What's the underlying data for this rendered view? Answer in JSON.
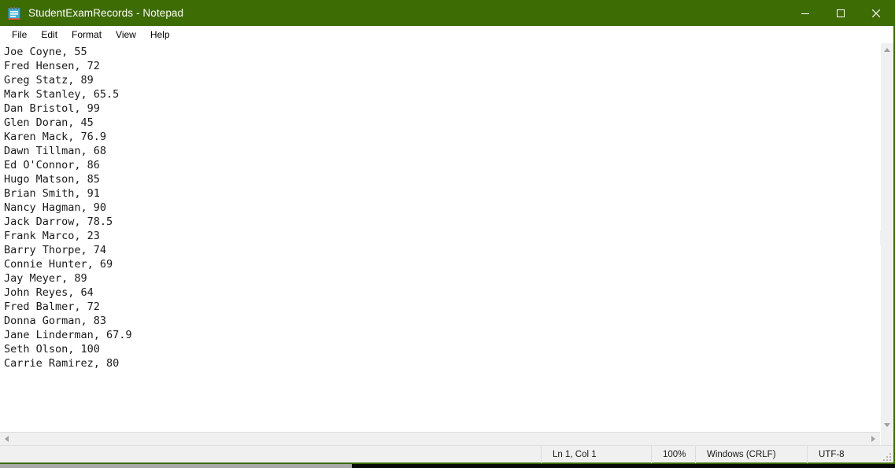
{
  "window": {
    "title": "StudentExamRecords - Notepad",
    "app_icon": "notepad-icon",
    "titlebar_color": "#3d6b04",
    "border_color": "#3c6a04"
  },
  "controls": {
    "minimize_label": "Minimize",
    "maximize_label": "Maximize",
    "close_label": "Close"
  },
  "menubar": {
    "items": [
      {
        "label": "File"
      },
      {
        "label": "Edit"
      },
      {
        "label": "Format"
      },
      {
        "label": "View"
      },
      {
        "label": "Help"
      }
    ]
  },
  "document": {
    "lines": [
      "Joe Coyne, 55",
      "Fred Hensen, 72",
      "Greg Statz, 89",
      "Mark Stanley, 65.5",
      "Dan Bristol, 99",
      "Glen Doran, 45",
      "Karen Mack, 76.9",
      "Dawn Tillman, 68",
      "Ed O'Connor, 86",
      "Hugo Matson, 85",
      "Brian Smith, 91",
      "Nancy Hagman, 90",
      "Jack Darrow, 78.5",
      "Frank Marco, 23",
      "Barry Thorpe, 74",
      "Connie Hunter, 69",
      "Jay Meyer, 89",
      "John Reyes, 64",
      "Fred Balmer, 72",
      "Donna Gorman, 83",
      "Jane Linderman, 67.9",
      "Seth Olson, 100",
      "Carrie Ramirez, 80"
    ]
  },
  "scrollbars": {
    "vertical_up": "scroll-up-arrow",
    "vertical_down": "scroll-down-arrow",
    "horizontal_left": "scroll-left-arrow",
    "horizontal_right": "scroll-right-arrow"
  },
  "statusbar": {
    "cursor_position": "Ln 1, Col 1",
    "zoom": "100%",
    "line_ending": "Windows (CRLF)",
    "encoding": "UTF-8"
  }
}
